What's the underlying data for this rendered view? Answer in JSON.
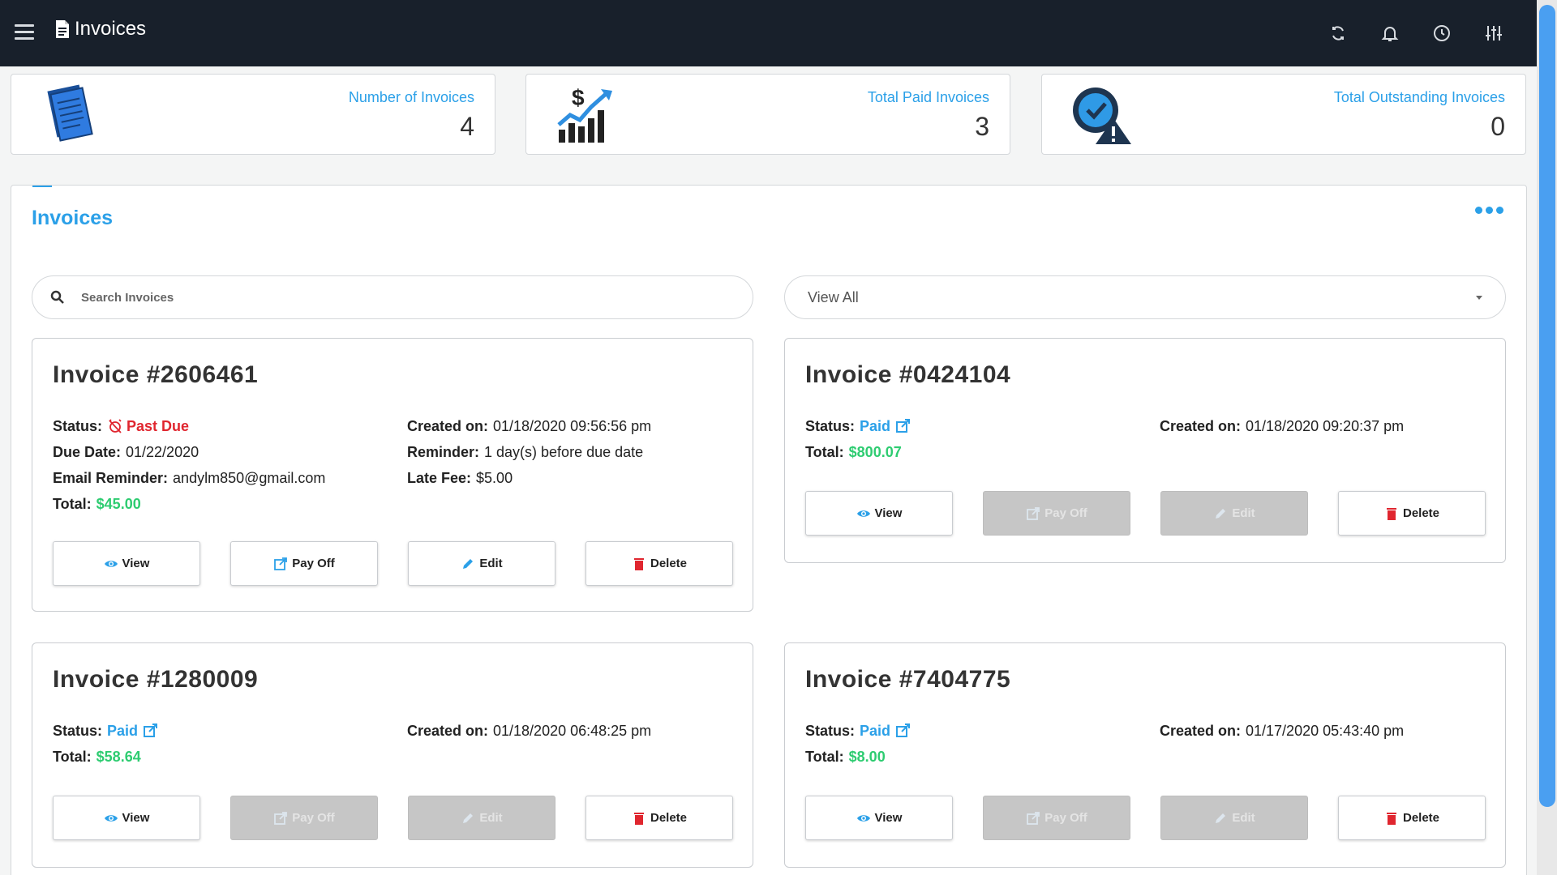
{
  "app": {
    "title": "Invoices"
  },
  "topbar": {
    "icons": [
      "refresh-icon",
      "bell-icon",
      "clock-icon",
      "sliders-icon"
    ]
  },
  "stats": [
    {
      "label": "Number of Invoices",
      "value": "4",
      "icon": "document-stack-icon"
    },
    {
      "label": "Total Paid Invoices",
      "value": "3",
      "icon": "dollar-growth-chart-icon"
    },
    {
      "label": "Total Outstanding Invoices",
      "value": "0",
      "icon": "clock-warning-icon"
    }
  ],
  "panel": {
    "title": "Invoices",
    "search": {
      "placeholder": "Search Invoices",
      "value": ""
    },
    "filter": {
      "selected": "View All"
    }
  },
  "labels": {
    "status": "Status:",
    "due_date": "Due Date:",
    "email_reminder": "Email Reminder:",
    "total": "Total:",
    "created_on": "Created on:",
    "reminder": "Reminder:",
    "late_fee": "Late Fee:"
  },
  "buttons": {
    "view": "View",
    "pay_off": "Pay Off",
    "edit": "Edit",
    "delete": "Delete"
  },
  "invoices": [
    {
      "title": "Invoice #2606461",
      "status": "Past Due",
      "due_date": "01/22/2020",
      "email_reminder": "andylm850@gmail.com",
      "total": "$45.00",
      "created_on": "01/18/2020 09:56:56 pm",
      "reminder": "1 day(s) before due date",
      "late_fee": "$5.00"
    },
    {
      "title": "Invoice #0424104",
      "status": "Paid",
      "total": "$800.07",
      "created_on": "01/18/2020 09:20:37 pm"
    },
    {
      "title": "Invoice #1280009",
      "status": "Paid",
      "total": "$58.64",
      "created_on": "01/18/2020 06:48:25 pm"
    },
    {
      "title": "Invoice #7404775",
      "status": "Paid",
      "total": "$8.00",
      "created_on": "01/17/2020 05:43:40 pm"
    }
  ],
  "colors": {
    "topbar": "#18202b",
    "accent": "#2ba0e8",
    "danger": "#e0262f",
    "money": "#2ecc71",
    "disabled": "#c6c6c6"
  }
}
